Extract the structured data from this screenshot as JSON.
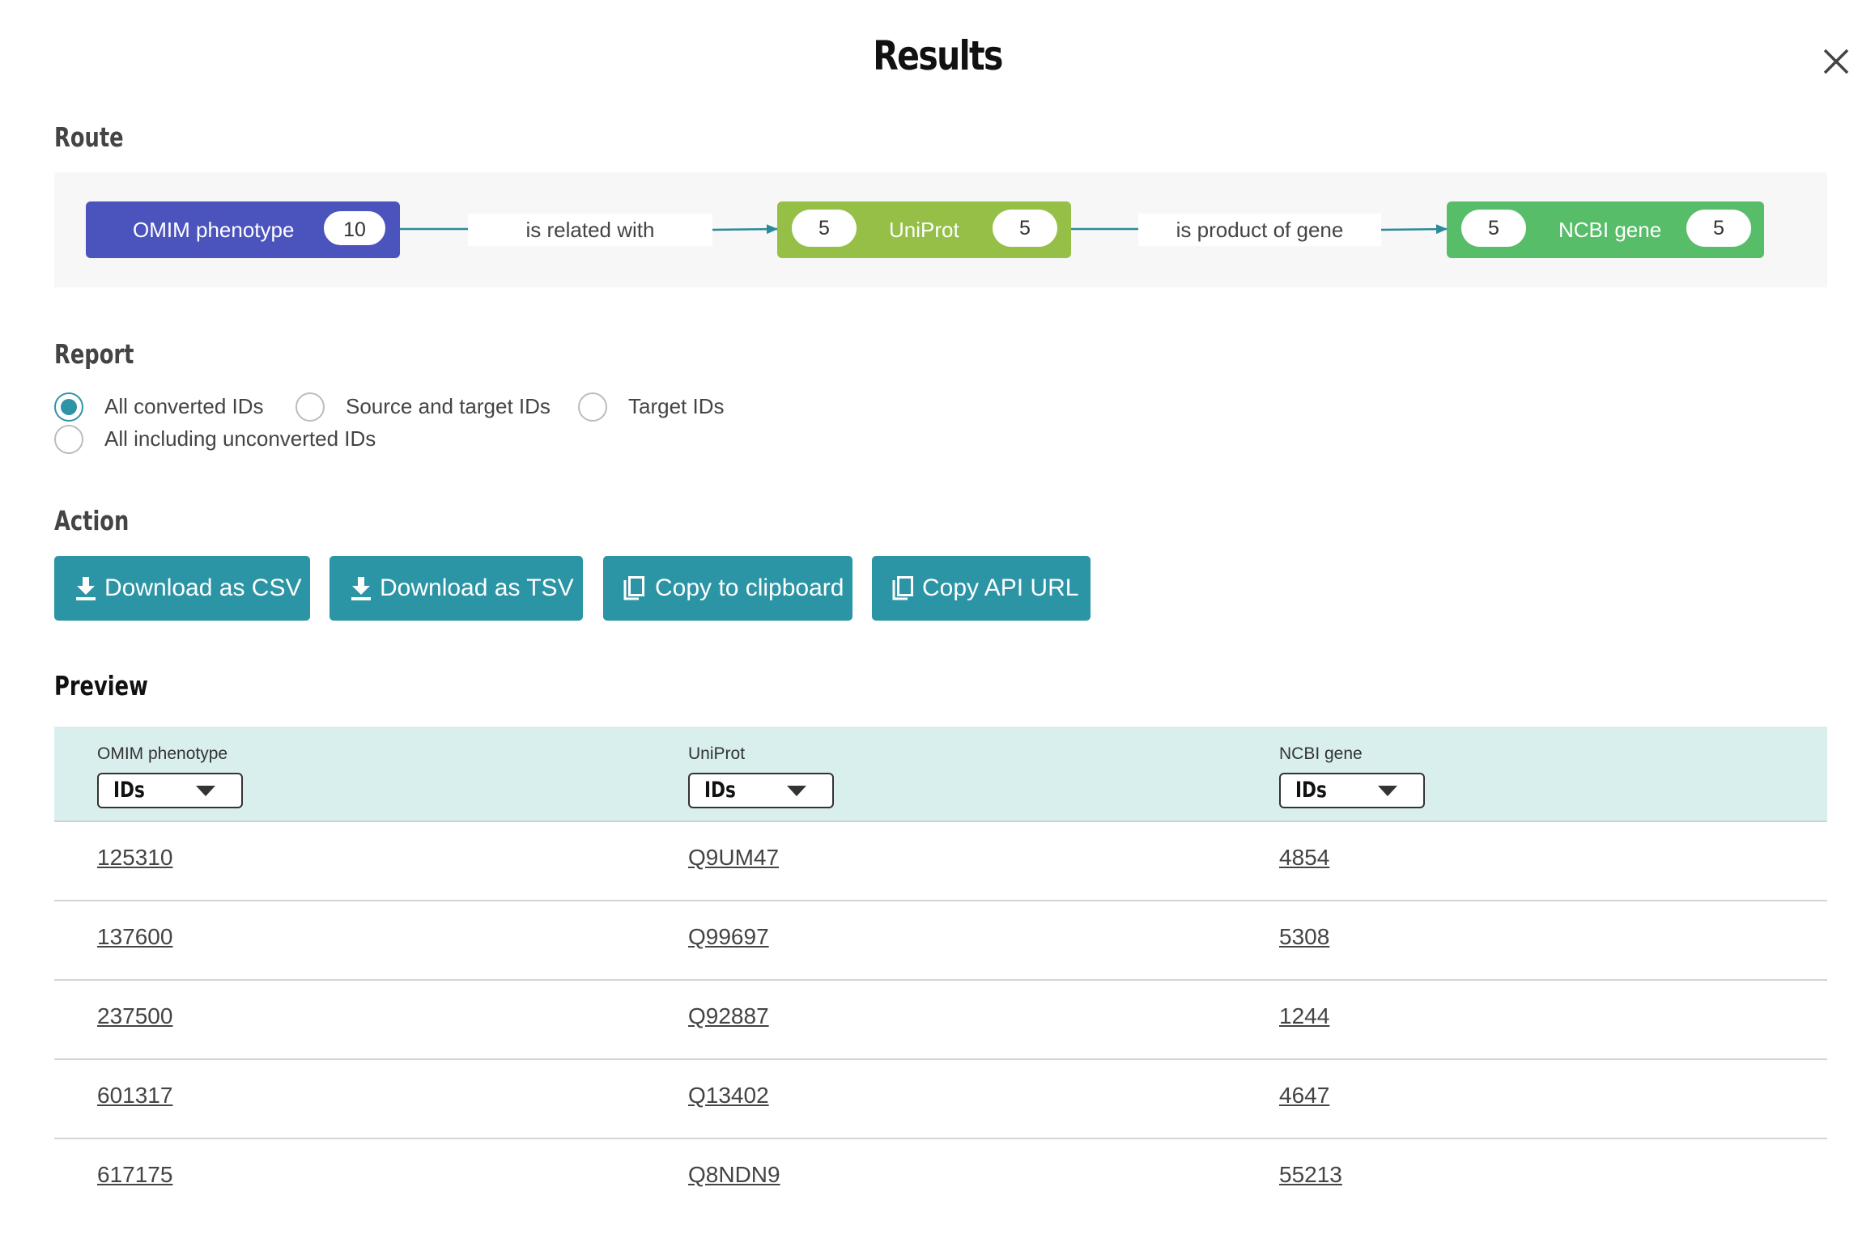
{
  "dialog": {
    "title": "Results",
    "close_icon": "close-icon"
  },
  "route": {
    "section_title": "Route",
    "nodes": [
      {
        "name": "OMIM phenotype",
        "out_count": "10",
        "color": "#4b53bc"
      },
      {
        "name": "UniProt",
        "in_count": "5",
        "out_count": "5",
        "color": "#95bf47"
      },
      {
        "name": "NCBI gene",
        "in_count": "5",
        "out_count": "5",
        "color": "#57bd68"
      }
    ],
    "edges": [
      {
        "label": "is related with"
      },
      {
        "label": "is product of gene"
      }
    ],
    "arrow_color": "#2b8a9a"
  },
  "report": {
    "section_title": "Report",
    "options": [
      {
        "label": "All converted IDs",
        "checked": true
      },
      {
        "label": "Source and target IDs",
        "checked": false
      },
      {
        "label": "Target IDs",
        "checked": false
      },
      {
        "label": "All including unconverted IDs",
        "checked": false
      }
    ]
  },
  "action": {
    "section_title": "Action",
    "buttons": [
      {
        "label": "Download as CSV",
        "icon": "download-icon"
      },
      {
        "label": "Download as TSV",
        "icon": "download-icon"
      },
      {
        "label": "Copy to clipboard",
        "icon": "copy-icon"
      },
      {
        "label": "Copy API URL",
        "icon": "copy-icon"
      }
    ],
    "button_color": "#2b95a6"
  },
  "preview": {
    "section_title": "Preview",
    "columns": [
      {
        "label": "OMIM phenotype",
        "select_value": "IDs"
      },
      {
        "label": "UniProt",
        "select_value": "IDs"
      },
      {
        "label": "NCBI gene",
        "select_value": "IDs"
      }
    ],
    "rows": [
      [
        "125310",
        "Q9UM47",
        "4854"
      ],
      [
        "137600",
        "Q99697",
        "5308"
      ],
      [
        "237500",
        "Q92887",
        "1244"
      ],
      [
        "601317",
        "Q13402",
        "4647"
      ],
      [
        "617175",
        "Q8NDN9",
        "55213"
      ]
    ],
    "header_bg": "#d9efee"
  }
}
